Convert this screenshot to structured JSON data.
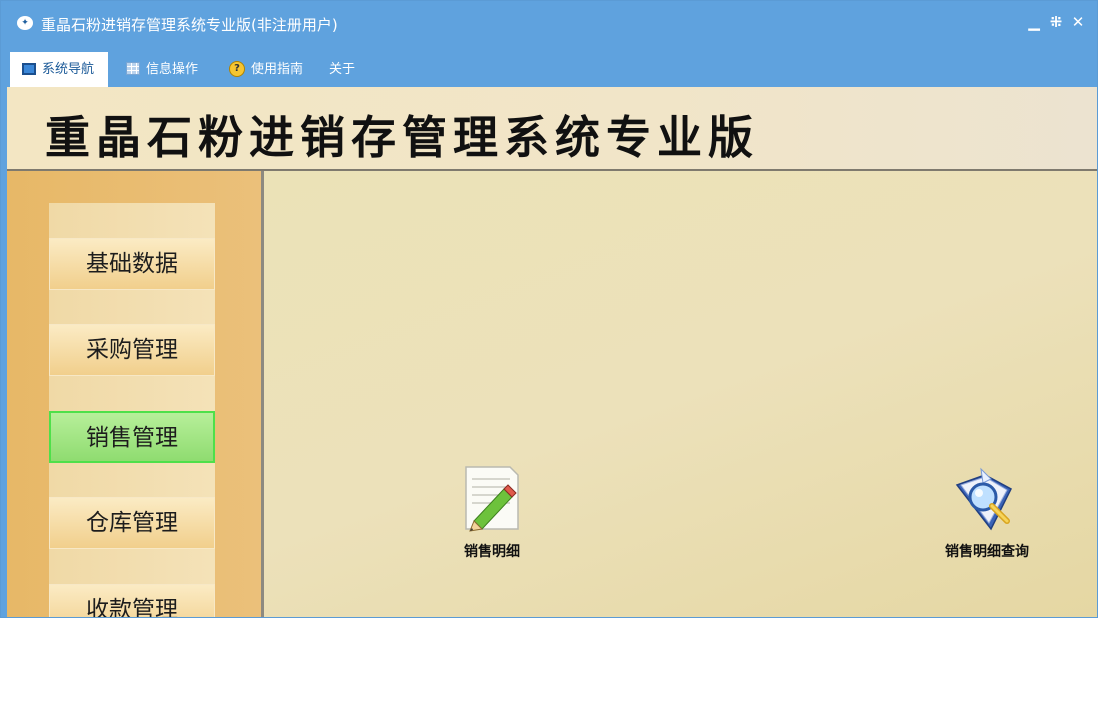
{
  "window": {
    "title": "重晶石粉进销存管理系统专业版(非注册用户)",
    "app_icon": "app-logo",
    "controls": [
      "minimize-icon",
      "restore-icon",
      "close-icon"
    ]
  },
  "menu": {
    "items": [
      {
        "label": "系统导航",
        "icon": "monitor-icon",
        "active": true
      },
      {
        "label": "信息操作",
        "icon": "grid-icon",
        "active": false
      },
      {
        "label": "使用指南",
        "icon": "help-icon",
        "active": false
      },
      {
        "label": "关于",
        "icon": "",
        "active": false
      }
    ]
  },
  "banner": {
    "title": "重晶石粉进销存管理系统专业版"
  },
  "sidebar": {
    "items": [
      {
        "label": "基础数据",
        "active": false
      },
      {
        "label": "采购管理",
        "active": false
      },
      {
        "label": "销售管理",
        "active": true
      },
      {
        "label": "仓库管理",
        "active": false
      },
      {
        "label": "收款管理",
        "active": false
      }
    ]
  },
  "main": {
    "functions": [
      {
        "label": "销售明细",
        "icon": "pencil-document-icon"
      },
      {
        "label": "销售明细查询",
        "icon": "magnifier-book-icon"
      }
    ]
  },
  "colors": {
    "titlebar": "#5fa2de",
    "sidebar": "#e7b867",
    "active_nav": "#8fdc70",
    "main_bg": "#ebe2b7"
  }
}
